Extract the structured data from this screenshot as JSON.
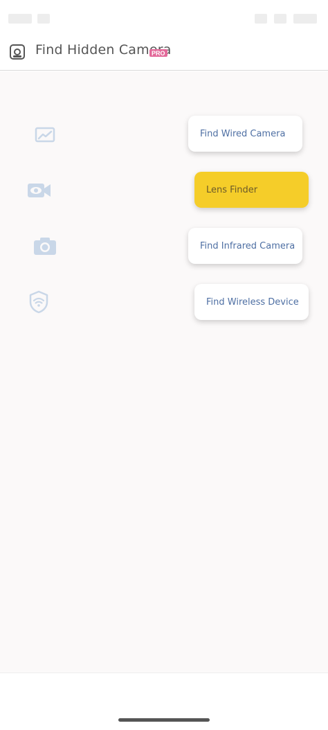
{
  "app": {
    "title": "Find Hidden Camera",
    "badge": "PRO"
  },
  "colors": {
    "accent": "#f5cd29",
    "badge": "#e36a9a",
    "button_text": "#4e6fa3",
    "icon": "#c9d7e8"
  },
  "menu": [
    {
      "label": "Find Wired Camera",
      "icon": "chart-icon",
      "active": false
    },
    {
      "label": "Lens Finder",
      "icon": "video-eye-icon",
      "active": true
    },
    {
      "label": "Find Infrared Camera",
      "icon": "camera-icon",
      "active": false
    },
    {
      "label": "Find Wireless Device",
      "icon": "wifi-shield-icon",
      "active": false
    }
  ]
}
